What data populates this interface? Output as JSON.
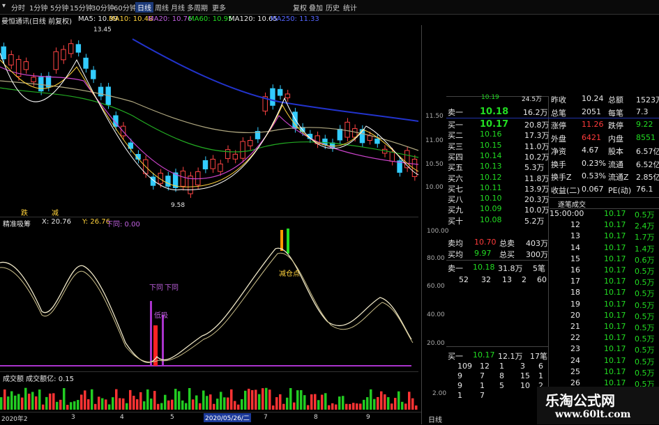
{
  "topbar": {
    "periods": [
      "分时",
      "1分钟",
      "5分钟",
      "15分钟",
      "30分钟",
      "60分钟",
      "日线",
      "周线",
      "月线",
      "多周期",
      "更多"
    ],
    "selected": "日线",
    "actions": [
      "复权",
      "叠加",
      "历史",
      "统计"
    ]
  },
  "title": {
    "stock": "曼恒通讯(日线 前复权)",
    "ma5": "MA5: 10.39",
    "ma10": "MA10: 10.48",
    "ma20": "MA20: 10.76",
    "ma60": "MA60: 10.95",
    "ma120": "MA120: 10.65",
    "ma250": "MA250: 11.33"
  },
  "price_axis": [
    "11.50",
    "11.00",
    "10.50",
    "10.00"
  ],
  "price_marks": {
    "high": "13.45",
    "low": "9.58"
  },
  "price_signals": [
    "跌",
    "减"
  ],
  "indicator": {
    "name": "精准吸筹",
    "x": "X: 20.76",
    "y": "Y: 26.76",
    "down": "下同: 0.00",
    "axis": [
      "100.00",
      "80.00",
      "60.00",
      "40.00",
      "20.00"
    ],
    "labels": [
      "下同",
      "下同",
      "低吸",
      "减仓点"
    ]
  },
  "volume": {
    "name": "成交额 成交额亿: 0.15",
    "axis": [
      "2.00"
    ]
  },
  "dates": [
    "2020年2",
    "3",
    "4",
    "5",
    "2020/05/26/二",
    "7",
    "8",
    "9",
    "日线"
  ],
  "quote": {
    "rows": [
      {
        "label": "卖一",
        "price": "10.18",
        "vol": "16.2万"
      },
      {
        "label": "买一",
        "price": "10.17",
        "vol": "20.8万"
      },
      {
        "label": "买二",
        "price": "10.16",
        "vol": "17.3万"
      },
      {
        "label": "买三",
        "price": "10.15",
        "vol": "11.0万"
      },
      {
        "label": "买四",
        "price": "10.14",
        "vol": "10.2万"
      },
      {
        "label": "买五",
        "price": "10.13",
        "vol": "5.3万"
      },
      {
        "label": "买六",
        "price": "10.12",
        "vol": "11.8万"
      },
      {
        "label": "买七",
        "price": "10.11",
        "vol": "13.9万"
      },
      {
        "label": "买八",
        "price": "10.10",
        "vol": "20.3万"
      },
      {
        "label": "买九",
        "price": "10.09",
        "vol": "10.0万"
      },
      {
        "label": "买十",
        "price": "10.08",
        "vol": "5.2万"
      }
    ],
    "top_partial": {
      "price": "10.19",
      "vol": "24.5万"
    },
    "avg_sell": {
      "label": "卖均",
      "price": "10.70",
      "tlabel": "总卖",
      "total": "403万"
    },
    "avg_buy": {
      "label": "买均",
      "price": "9.97",
      "tlabel": "总买",
      "total": "300万"
    },
    "sell1": {
      "label": "卖一",
      "price": "10.18",
      "vol": "31.8万",
      "count": "5笔"
    },
    "sell_queue": [
      "52",
      "32",
      "13",
      "2",
      "60"
    ],
    "buy1": {
      "label": "买一",
      "price": "10.17",
      "vol": "12.1万",
      "count": "17笔"
    },
    "buy_queue": [
      [
        "109",
        "12",
        "1",
        "3",
        "6"
      ],
      [
        "9",
        "7",
        "8",
        "15",
        "1"
      ],
      [
        "9",
        "1",
        "5",
        "10",
        "2"
      ],
      [
        "1",
        "7",
        "",
        "",
        ""
      ]
    ]
  },
  "stats": [
    {
      "l1": "昨收",
      "v1": "10.24",
      "l2": "总额",
      "v2": "1523万",
      "c1": "wht",
      "c2": "wht"
    },
    {
      "l1": "总笔",
      "v1": "2051",
      "l2": "每笔",
      "v2": "7.3",
      "c1": "wht",
      "c2": "wht"
    },
    {
      "l1": "涨停",
      "v1": "11.26",
      "l2": "跌停",
      "v2": "9.22",
      "c1": "red",
      "c2": "grn"
    },
    {
      "l1": "外盘",
      "v1": "6421",
      "l2": "内盘",
      "v2": "8551",
      "c1": "red",
      "c2": "grn"
    },
    {
      "l1": "净资",
      "v1": "4.67",
      "l2": "股本",
      "v2": "6.57亿",
      "c1": "wht",
      "c2": "wht"
    },
    {
      "l1": "换手",
      "v1": "0.23%",
      "l2": "流通",
      "v2": "6.52亿",
      "c1": "wht",
      "c2": "wht"
    },
    {
      "l1": "换手Z",
      "v1": "0.53%",
      "l2": "流通Z",
      "v2": "2.85亿",
      "c1": "wht",
      "c2": "wht"
    },
    {
      "l1": "收益(二)",
      "v1": "0.067",
      "l2": "PE(动)",
      "v2": "76.1",
      "c1": "wht",
      "c2": "wht"
    }
  ],
  "ticks_header": "逐笔成交",
  "ticks": [
    {
      "t": "15:00:00",
      "p": "10.17",
      "v": "0.5万"
    },
    {
      "t": "12",
      "p": "10.17",
      "v": "2.4万"
    },
    {
      "t": "13",
      "p": "10.17",
      "v": "1.7万"
    },
    {
      "t": "14",
      "p": "10.17",
      "v": "1.4万"
    },
    {
      "t": "15",
      "p": "10.17",
      "v": "0.6万"
    },
    {
      "t": "16",
      "p": "10.17",
      "v": "0.5万"
    },
    {
      "t": "17",
      "p": "10.17",
      "v": "0.5万"
    },
    {
      "t": "18",
      "p": "10.17",
      "v": "0.5万"
    },
    {
      "t": "19",
      "p": "10.17",
      "v": "0.5万"
    },
    {
      "t": "20",
      "p": "10.17",
      "v": "0.5万"
    },
    {
      "t": "21",
      "p": "10.17",
      "v": "0.5万"
    },
    {
      "t": "22",
      "p": "10.17",
      "v": "0.5万"
    },
    {
      "t": "23",
      "p": "10.17",
      "v": "0.5万"
    },
    {
      "t": "24",
      "p": "10.17",
      "v": "0.5万"
    },
    {
      "t": "25",
      "p": "10.17",
      "v": "0.5万"
    },
    {
      "t": "26",
      "p": "10.17",
      "v": "0.5万"
    }
  ],
  "watermark": {
    "cn": "乐淘公式网",
    "url": "www.60lt.com"
  }
}
